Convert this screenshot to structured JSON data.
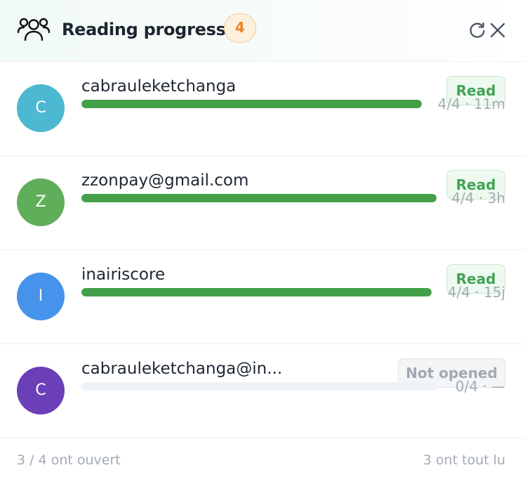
{
  "header": {
    "title": "Reading progress",
    "count": "4",
    "icon": "users-group-icon",
    "refresh_icon": "refresh-icon",
    "close_icon": "close-icon"
  },
  "readers": [
    {
      "initial": "C",
      "name": "cabrauleketchanga",
      "status": "Read",
      "status_type": "read",
      "meta": "4/4 · 11m",
      "progress": 1.0,
      "avatar_color": "#4db8d1"
    },
    {
      "initial": "Z",
      "name": "zzonpay@gmail.com",
      "status": "Read",
      "status_type": "read",
      "meta": "4/4 · 3h",
      "progress": 1.0,
      "avatar_color": "#5fae5a"
    },
    {
      "initial": "I",
      "name": "inairiscore",
      "status": "Read",
      "status_type": "read",
      "meta": "4/4 · 15j",
      "progress": 1.0,
      "avatar_color": "#4693ec"
    },
    {
      "initial": "C",
      "name": "cabrauleketchanga@in...",
      "status": "Not opened",
      "status_type": "unopened",
      "meta": "0/4 · —",
      "progress": 0.0,
      "avatar_color": "#6a3fb8"
    }
  ],
  "footer": {
    "opened": "3 / 4 ont ouvert",
    "read_all": "3 ont tout lu"
  },
  "colors": {
    "accent_green": "#43a048",
    "badge_orange": "#e9852b"
  }
}
